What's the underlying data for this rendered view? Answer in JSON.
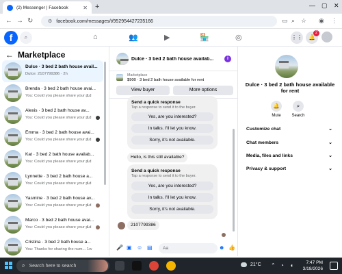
{
  "browser": {
    "tab_title": "(2) Messenger | Facebook",
    "tab_close": "✕",
    "new_tab": "+",
    "url": "facebook.com/messages/t/952954427235166",
    "window_controls": [
      "—",
      "▢",
      "✕"
    ]
  },
  "fbnav": {
    "logo": "f",
    "notification_count": "2"
  },
  "left_panel": {
    "title": "Marketplace",
    "conversations": [
      {
        "name": "Dulce · 3 bed 2 bath house avail...",
        "preview": "Dulce: 2107799386 · 2h",
        "time": "",
        "active": true,
        "bold": true
      },
      {
        "name": "Brenda · 3 bed 2 bath house avai...",
        "preview": "You: Could you please share your p...",
        "time": "1d",
        "active": false,
        "bold": false
      },
      {
        "name": "Alexis · 3 bed 2 bath house av...",
        "preview": "You: Could you please share your p...",
        "time": "1d",
        "active": false,
        "bold": false
      },
      {
        "name": "Emma · 3 bed 2 bath house avai...",
        "preview": "You: Could you please share your p...",
        "time": "1d",
        "active": false,
        "bold": false
      },
      {
        "name": "Kat · 3 bed 2 bath house availab...",
        "preview": "You: Could you please share your p...",
        "time": "1d",
        "active": false,
        "bold": false
      },
      {
        "name": "Lynnette · 3 bed 2 bath house a...",
        "preview": "You: Could you please share your p...",
        "time": "1d",
        "active": false,
        "bold": false
      },
      {
        "name": "Yasmine · 3 bed 2 bath house av...",
        "preview": "You: Could you please share your p...",
        "time": "1d",
        "active": false,
        "bold": false
      },
      {
        "name": "Marco · 3 bed 2 bath house avai...",
        "preview": "You: Could you please share your p...",
        "time": "1d",
        "active": false,
        "bold": false
      },
      {
        "name": "Cristina · 3 bed 2 bath house a...",
        "preview": "You: Thanks for sharing the num...",
        "time": "1w",
        "active": false,
        "bold": false
      }
    ]
  },
  "chat": {
    "title": "Dulce · 3 bed 2 bath house availab...",
    "info_icon": "i",
    "marketplace_label": "Marketplace",
    "listing": "$900 · 3 bed 2 bath house available for rent",
    "view_buyer": "View buyer",
    "more_options": "More options",
    "quick_reply_title": "Send a quick response",
    "quick_reply_sub": "Tap a response to send it to the buyer.",
    "quick_replies": [
      "Yes, are you interested?",
      "In talks. I'll let you know.",
      "Sorry, it's not available."
    ],
    "follow_up": "Hello, is this still available?",
    "phone_message": "2107799386",
    "composer_placeholder": "Aa"
  },
  "right_panel": {
    "title": "Dulce · 3 bed 2 bath house available for rent",
    "mute": "Mute",
    "search": "Search",
    "sections": [
      "Customize chat",
      "Chat members",
      "Media, files and links",
      "Privacy & support"
    ]
  },
  "taskbar": {
    "search_placeholder": "Search here to search",
    "weather": "21°C",
    "time": "7:47 PM",
    "date": "3/18/2026"
  },
  "colors": {
    "accent": "#0866ff",
    "active_row": "#ebf5ff",
    "badge": "#e41e3f",
    "info": "#7a32e0"
  }
}
